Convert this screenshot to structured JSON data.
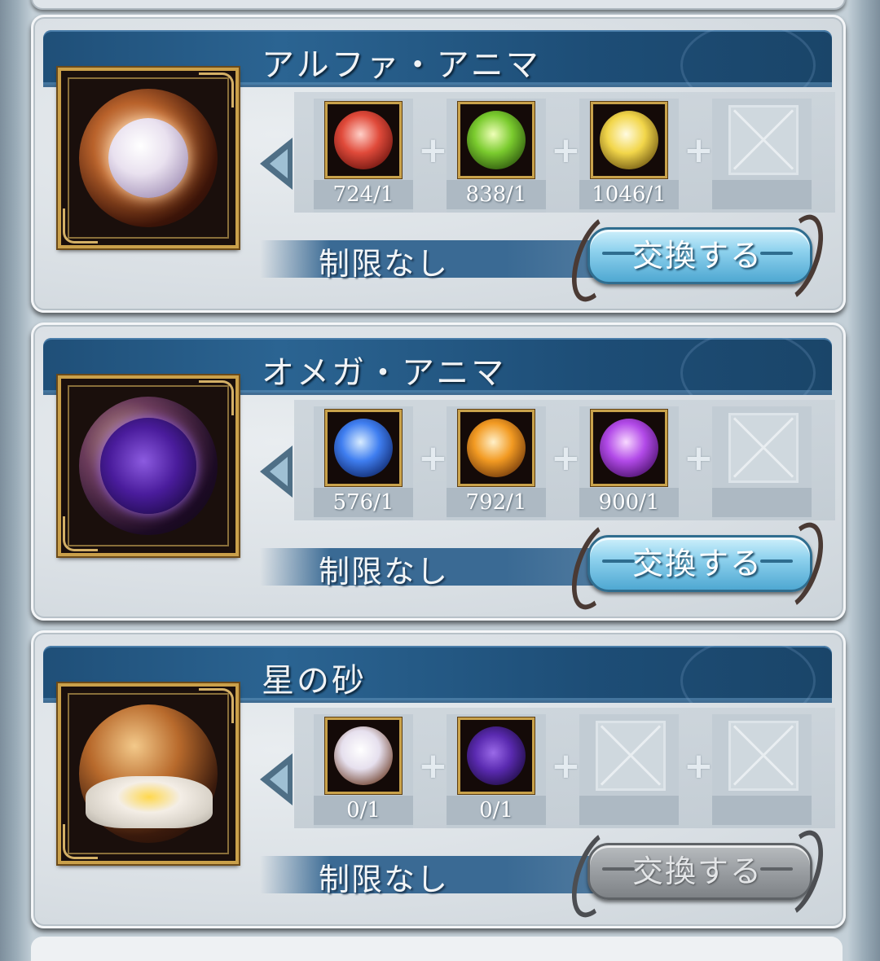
{
  "items": [
    {
      "title": "アルファ・アニマ",
      "icon": "alpha-anima-icon",
      "materials": [
        {
          "icon": "red-anima-icon",
          "count": "724/1",
          "color": "#e04a3a"
        },
        {
          "icon": "green-anima-icon",
          "count": "838/1",
          "color": "#7acb2e"
        },
        {
          "icon": "yellow-anima-icon",
          "count": "1046/1",
          "color": "#f2d64a"
        }
      ],
      "limit": "制限なし",
      "button": "交換する",
      "enabled": true
    },
    {
      "title": "オメガ・アニマ",
      "icon": "omega-anima-icon",
      "materials": [
        {
          "icon": "blue-anima-icon",
          "count": "576/1",
          "color": "#3f7ef0"
        },
        {
          "icon": "orange-anima-icon",
          "count": "792/1",
          "color": "#f29a22"
        },
        {
          "icon": "purple-anima-icon",
          "count": "900/1",
          "color": "#b24ae8"
        }
      ],
      "limit": "制限なし",
      "button": "交換する",
      "enabled": true
    },
    {
      "title": "星の砂",
      "icon": "star-sand-icon",
      "materials": [
        {
          "icon": "alpha-anima-icon",
          "count": "0/1",
          "color": "#e6e0ee"
        },
        {
          "icon": "omega-anima-icon",
          "count": "0/1",
          "color": "#5a2ab0"
        }
      ],
      "limit": "制限なし",
      "button": "交換する",
      "enabled": false
    }
  ]
}
